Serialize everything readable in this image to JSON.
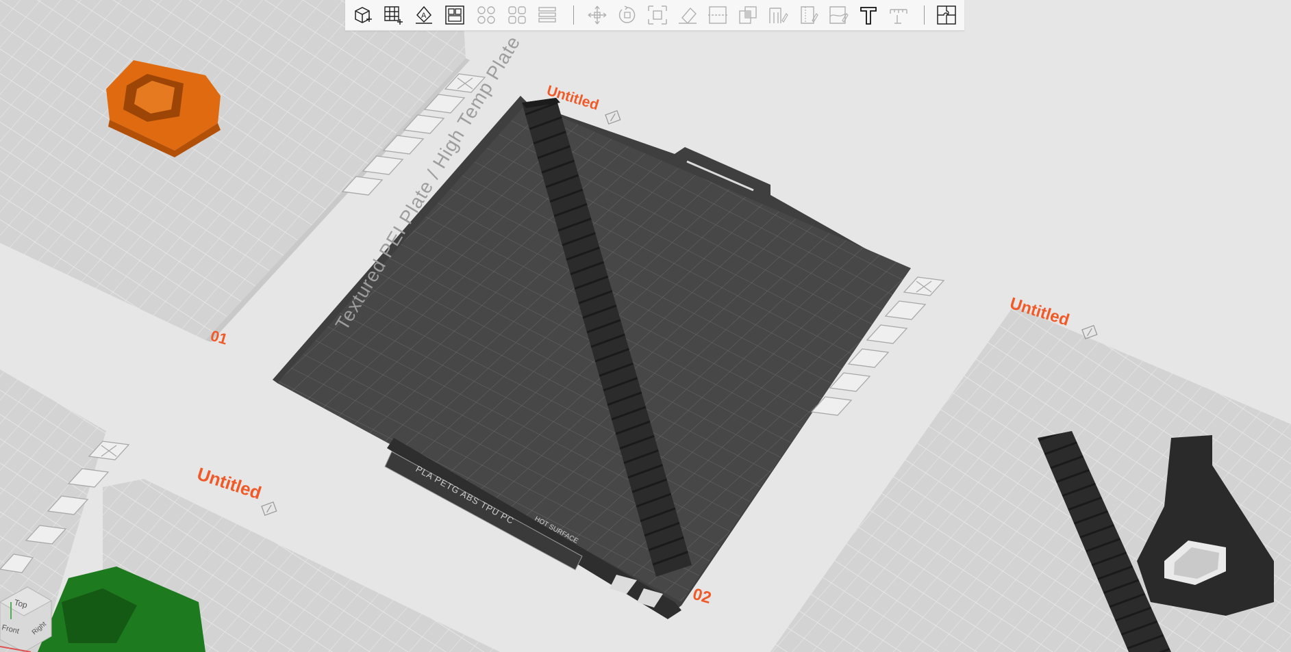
{
  "toolbar": {
    "groups": [
      [
        {
          "name": "add-object-icon",
          "label": "Add",
          "enabled": true
        },
        {
          "name": "add-plate-icon",
          "label": "Add plate",
          "enabled": true
        },
        {
          "name": "auto-orient-icon",
          "label": "Auto orient",
          "enabled": true
        },
        {
          "name": "arrange-icon",
          "label": "Arrange",
          "enabled": true
        }
      ],
      [
        {
          "name": "split-objects-icon",
          "label": "Split to objects",
          "enabled": false
        },
        {
          "name": "split-parts-icon",
          "label": "Split to parts",
          "enabled": false
        },
        {
          "name": "layers-icon",
          "label": "Variable layer height",
          "enabled": false
        }
      ],
      [
        {
          "name": "move-icon",
          "label": "Move",
          "enabled": false
        },
        {
          "name": "rotate-icon",
          "label": "Rotate",
          "enabled": false
        },
        {
          "name": "scale-icon",
          "label": "Scale",
          "enabled": false
        },
        {
          "name": "lay-on-face-icon",
          "label": "Lay on face",
          "enabled": false
        },
        {
          "name": "cut-icon",
          "label": "Cut",
          "enabled": false
        },
        {
          "name": "mesh-boolean-icon",
          "label": "Mesh boolean",
          "enabled": false
        },
        {
          "name": "support-paint-icon",
          "label": "Support painting",
          "enabled": false
        },
        {
          "name": "seam-paint-icon",
          "label": "Seam painting",
          "enabled": false
        },
        {
          "name": "color-paint-icon",
          "label": "Color painting",
          "enabled": false
        },
        {
          "name": "text-tool-icon",
          "label": "Text shape",
          "enabled": true
        },
        {
          "name": "measure-icon",
          "label": "Measure",
          "enabled": false
        }
      ],
      [
        {
          "name": "assembly-view-icon",
          "label": "Assembly view",
          "enabled": true
        }
      ]
    ]
  },
  "plates": [
    {
      "id": "plate-01",
      "number": "01",
      "name": "",
      "active": false
    },
    {
      "id": "plate-02",
      "number": "02",
      "name": "Untitled",
      "active": true
    },
    {
      "id": "plate-03",
      "number": "",
      "name": "Untitled",
      "active": false
    },
    {
      "id": "plate-04",
      "number": "",
      "name": "Untitled",
      "active": false
    }
  ],
  "plate_icons": [
    "close-plate-icon",
    "auto-orient-plate-icon",
    "arrange-plate-icon",
    "lock-plate-icon",
    "plate-settings-icon",
    "move-plate-icon"
  ],
  "active_bed": {
    "label": "Textured PEI Plate / High Temp Plate",
    "materials": "PLA  PETG  ABS  TPU  PC",
    "warning": "HOT SURFACE"
  },
  "view_cube": {
    "top": "Top",
    "front": "Front",
    "right": "Right"
  },
  "colors": {
    "background": "#e6e6e6",
    "bed_grid_light": "#d6d6d6",
    "bed_dark": "#454545",
    "accent_orange": "#f05a28",
    "object_orange": "#e06a10",
    "object_green": "#1e7a1e",
    "object_dark": "#2a2a2a"
  }
}
